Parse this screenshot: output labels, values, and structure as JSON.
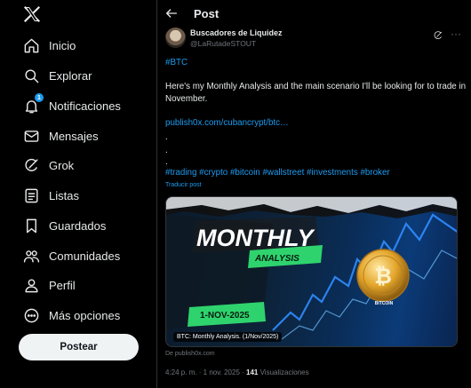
{
  "brand": {
    "logo_icon": "x-logo-icon"
  },
  "sidebar": {
    "items": [
      {
        "label": "Inicio",
        "icon": "home-icon"
      },
      {
        "label": "Explorar",
        "icon": "search-icon"
      },
      {
        "label": "Notificaciones",
        "icon": "bell-icon",
        "badge": "1"
      },
      {
        "label": "Mensajes",
        "icon": "mail-icon"
      },
      {
        "label": "Grok",
        "icon": "grok-icon"
      },
      {
        "label": "Listas",
        "icon": "list-icon"
      },
      {
        "label": "Guardados",
        "icon": "bookmark-icon"
      },
      {
        "label": "Comunidades",
        "icon": "people-icon"
      },
      {
        "label": "Perfil",
        "icon": "person-icon"
      },
      {
        "label": "Más opciones",
        "icon": "more-circle-icon"
      }
    ],
    "post_button": "Postear"
  },
  "header": {
    "title": "Post"
  },
  "post": {
    "author_name": "Buscadores de Liquidez",
    "author_handle": "@LaRutadeSTOUT",
    "hashtag_btc": "#BTC",
    "body": "Here's my Monthly Analysis and the main scenario I'll be looking for to trade in November.",
    "link": "publish0x.com/cubancrypt/btc…",
    "dot1": ".",
    "dot2": ".",
    "dot3": ".",
    "hashtags": "#trading #crypto #bitcoin #wallstreet #investments  #broker",
    "translate": "Traducir post",
    "media": {
      "headline": "MONTHLY",
      "subheadline": "ANALYSIS",
      "date": "1-NOV-2025",
      "coin_label": "BITCOIN",
      "coin_symbol": "₿",
      "caption": "BTC: Monthly Analysis. (1/Nov/2025)"
    },
    "source": "De publish0x.com",
    "time": "4:24 p. m. · 1 nov. 2025 · ",
    "views_count": "141",
    "views_label": " Visualizaciones"
  },
  "colors": {
    "accent": "#1d9bf0",
    "green": "#34e27a",
    "background": "#000000"
  }
}
